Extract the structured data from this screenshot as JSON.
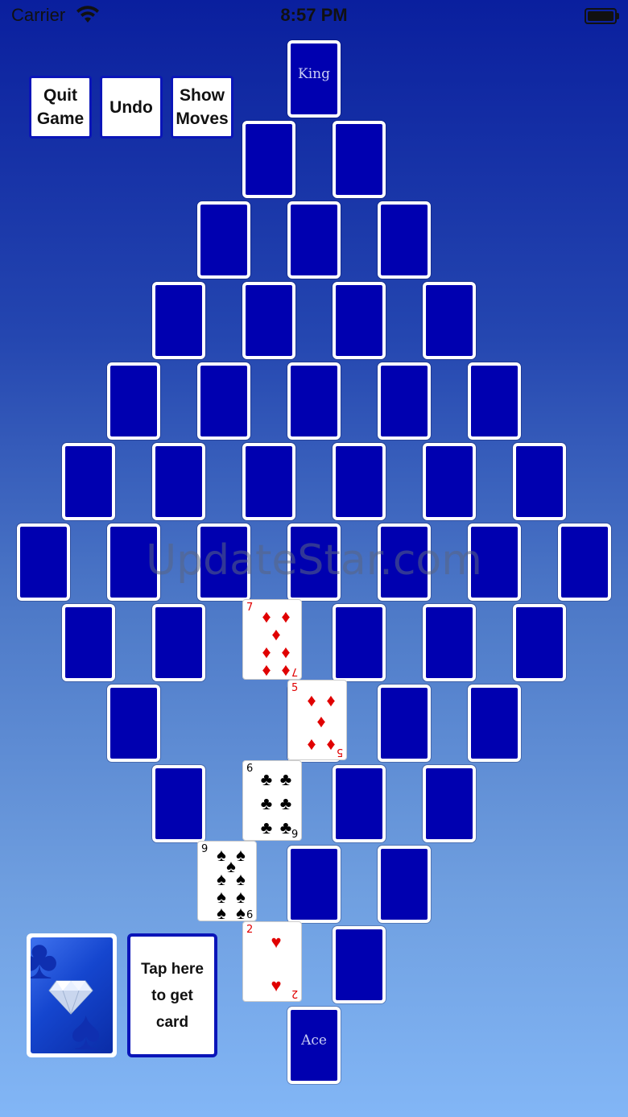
{
  "status_bar": {
    "carrier": "Carrier",
    "time": "8:57 PM"
  },
  "buttons": {
    "quit": "Quit\nGame",
    "undo": "Undo",
    "show_moves": "Show\nMoves"
  },
  "top_card_label": "King",
  "bottom_card_label": "Ace",
  "tap_card_text": "Tap here\nto get\ncard",
  "watermark": "UpdateStar.com",
  "face_cards": {
    "seven_diamonds": {
      "rank": "7",
      "suit": "♦"
    },
    "five_diamonds": {
      "rank": "5",
      "suit": "♦"
    },
    "six_clubs": {
      "rank": "6",
      "suit": "♣"
    },
    "nine_spades": {
      "rank": "9",
      "suit": "♠"
    },
    "two_hearts": {
      "rank": "2",
      "suit": "♥"
    }
  },
  "colors": {
    "card_back": "#0000b0",
    "button_border": "#0a15b8",
    "red_suit": "#e00000"
  }
}
